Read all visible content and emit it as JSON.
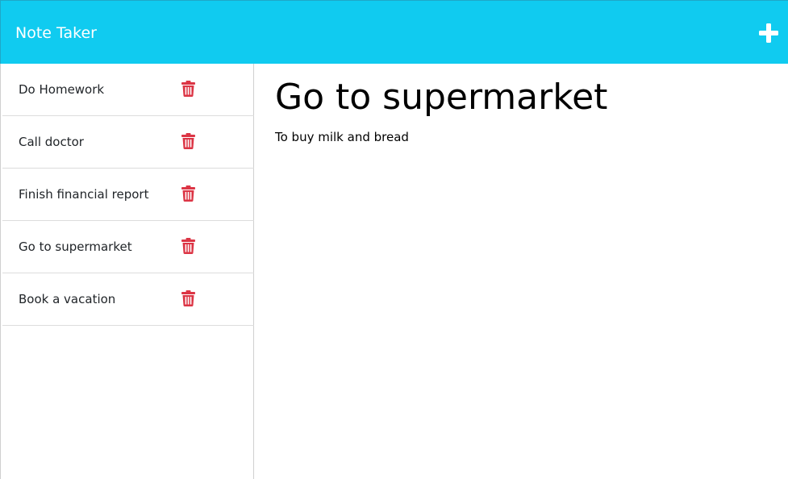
{
  "app": {
    "title": "Note Taker"
  },
  "icons": {
    "add": "plus-icon",
    "delete": "trash-icon"
  },
  "colors": {
    "navbar": "#10cbf0",
    "delete": "#dc3545"
  },
  "notes": [
    {
      "title": "Do Homework"
    },
    {
      "title": "Call doctor"
    },
    {
      "title": "Finish financial report"
    },
    {
      "title": "Go to supermarket"
    },
    {
      "title": "Book a vacation"
    }
  ],
  "active_note": {
    "title": "Go to supermarket",
    "text": "To buy milk and bread"
  }
}
